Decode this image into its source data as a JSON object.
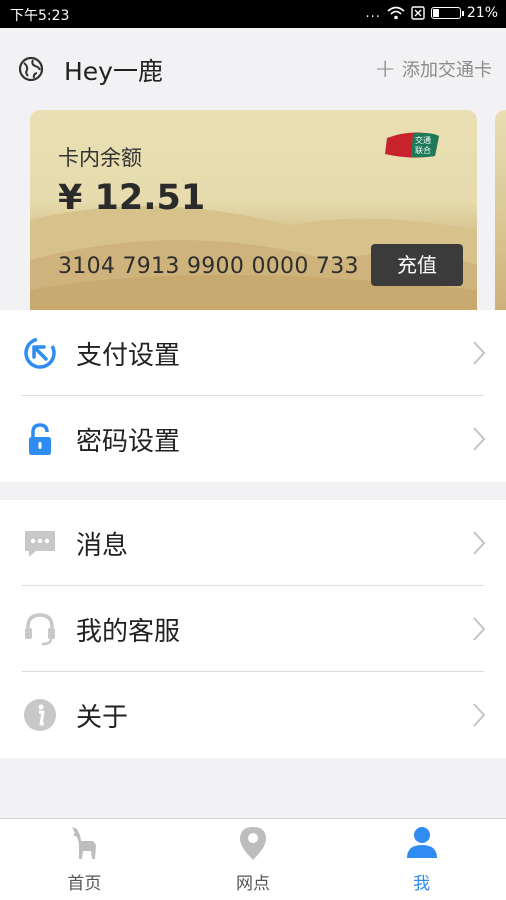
{
  "status_bar": {
    "time": "下午5:23",
    "dots": "...",
    "battery_text": "21%",
    "battery_level": 0.21
  },
  "header": {
    "title": "Hey一鹿",
    "add_card_label": "添加交通卡"
  },
  "card": {
    "balance_label": "卡内余额",
    "balance": "¥ 12.51",
    "card_number": "3104 7913 9900 0000 733",
    "recharge_label": "充值",
    "logo_top": "交通",
    "logo_bottom": "联合"
  },
  "menu_group_1": [
    {
      "label": "支付设置",
      "icon": "payment-settings-icon"
    },
    {
      "label": "密码设置",
      "icon": "lock-icon"
    }
  ],
  "menu_group_2": [
    {
      "label": "消息",
      "icon": "message-icon"
    },
    {
      "label": "我的客服",
      "icon": "headset-icon"
    },
    {
      "label": "关于",
      "icon": "info-icon"
    }
  ],
  "tabs": [
    {
      "label": "首页",
      "icon": "deer-icon",
      "active": false
    },
    {
      "label": "网点",
      "icon": "location-pin-icon",
      "active": false
    },
    {
      "label": "我",
      "icon": "user-icon",
      "active": true
    }
  ],
  "colors": {
    "accent": "#2f8cf0",
    "inactive_icon": "#bdbdbd",
    "text": "#222222"
  }
}
